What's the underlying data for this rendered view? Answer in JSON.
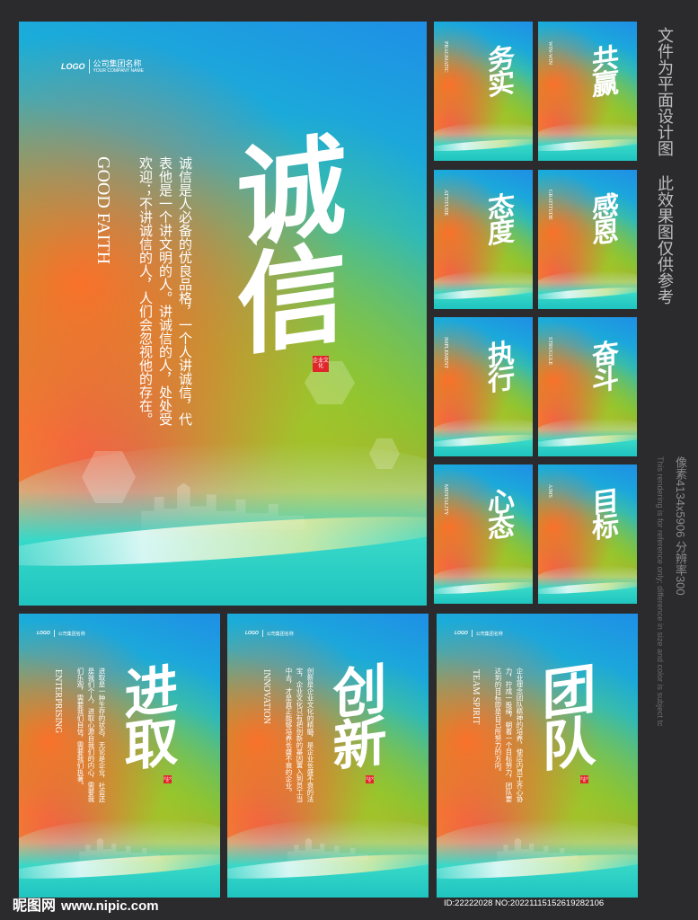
{
  "logo": {
    "mark": "LOGO",
    "company_cn": "公司集团名称",
    "company_en": "YOUR COMPANY NAME"
  },
  "seal_text": "企业文化",
  "main_poster": {
    "title": "诚信",
    "en": "GOOD FAITH",
    "body_lines": [
      "诚信是人必备的优良品格，一个人",
      "讲诚信，代表他是一个讲文明的人。",
      "讲诚信的人，处处受欢迎；不讲诚",
      "信的人，人们会忽视他的存在。"
    ]
  },
  "small_posters": [
    {
      "title": "务实",
      "en": "PRAGMATIC"
    },
    {
      "title": "共赢",
      "en": "WIN-WIN"
    },
    {
      "title": "态度",
      "en": "ATTITUDE"
    },
    {
      "title": "感恩",
      "en": "GRATITUDE"
    },
    {
      "title": "执行",
      "en": "IMPLEMENT"
    },
    {
      "title": "奋斗",
      "en": "STRUGGLE"
    },
    {
      "title": "心态",
      "en": "MENTALITY"
    },
    {
      "title": "目标",
      "en": "AIMS"
    }
  ],
  "bottom_posters": [
    {
      "title": "进取",
      "en": "ENTERPRISING",
      "body_lines": [
        "进取是一种生存的状态，无论是企",
        "业，社会还是我们个人，进取心源",
        "自我们的内心，需要我们乐观，需",
        "要我们自信，需要我们执著。"
      ]
    },
    {
      "title": "创新",
      "en": "INNOVATION",
      "body_lines": [
        "创新是企业文化的精髓，是企业长",
        "盛不衰的法宝，企业文化只有把创",
        "新的基因置入到员工当中去，才是",
        "真正能够培养长盛不衰的企业。"
      ]
    },
    {
      "title": "团队",
      "en": "TEAM SPIRIT",
      "body_lines": [
        "企业理念团队精神的培养，使店内",
        "员工齐心协力，拧成一股绳，朝着",
        "一个目标努力，团队要达到的目标",
        "即是自己所努力的方向。"
      ]
    }
  ],
  "side_note": {
    "cn": "文件为平面设计图 此效果图仅供参考",
    "en": "This rendering is for reference only; difference in size and color is subject to actual effect reference"
  },
  "pixel_info": "像素4134x5906 分辨率300",
  "footer": {
    "site_logo": "昵图网",
    "site_url": "www.nipic.com",
    "id_line": "ID:22222028 NO:20221115152619282106"
  }
}
